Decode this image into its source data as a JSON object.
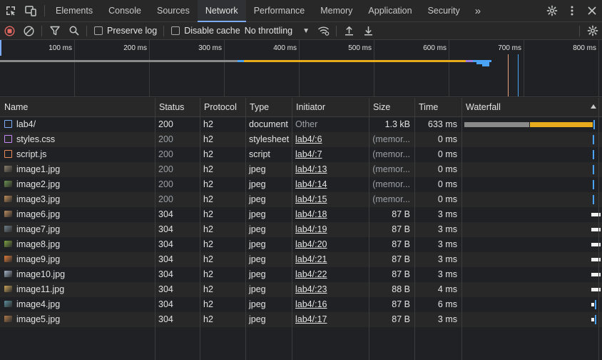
{
  "tabs": [
    "Elements",
    "Console",
    "Sources",
    "Network",
    "Performance",
    "Memory",
    "Application",
    "Security"
  ],
  "active_tab": "Network",
  "toolbar": {
    "preserve_log": "Preserve log",
    "disable_cache": "Disable cache",
    "throttling": "No throttling"
  },
  "overview": {
    "ticks": [
      "100 ms",
      "200 ms",
      "300 ms",
      "400 ms",
      "500 ms",
      "600 ms",
      "700 ms",
      "800 ms"
    ]
  },
  "columns": [
    "Name",
    "Status",
    "Protocol",
    "Type",
    "Initiator",
    "Size",
    "Time",
    "Waterfall"
  ],
  "rows": [
    {
      "name": "lab4/",
      "status": "200",
      "protocol": "h2",
      "type": "document",
      "initiator": "Other",
      "size": "1.3 kB",
      "time": "633 ms",
      "icon": "document-icon",
      "status_dim": false,
      "initiator_dim": true,
      "size_dim": false
    },
    {
      "name": "styles.css",
      "status": "200",
      "protocol": "h2",
      "type": "stylesheet",
      "initiator": "lab4/:6",
      "size": "(memor...",
      "time": "0 ms",
      "icon": "stylesheet-icon",
      "status_dim": true,
      "initiator_dim": false,
      "size_dim": true
    },
    {
      "name": "script.js",
      "status": "200",
      "protocol": "h2",
      "type": "script",
      "initiator": "lab4/:7",
      "size": "(memor...",
      "time": "0 ms",
      "icon": "script-icon",
      "status_dim": true,
      "initiator_dim": false,
      "size_dim": true
    },
    {
      "name": "image1.jpg",
      "status": "200",
      "protocol": "h2",
      "type": "jpeg",
      "initiator": "lab4/:13",
      "size": "(memor...",
      "time": "0 ms",
      "icon": "image-thumbnail-icon",
      "status_dim": true,
      "initiator_dim": false,
      "size_dim": true
    },
    {
      "name": "image2.jpg",
      "status": "200",
      "protocol": "h2",
      "type": "jpeg",
      "initiator": "lab4/:14",
      "size": "(memor...",
      "time": "0 ms",
      "icon": "image-thumbnail-icon",
      "status_dim": true,
      "initiator_dim": false,
      "size_dim": true
    },
    {
      "name": "image3.jpg",
      "status": "200",
      "protocol": "h2",
      "type": "jpeg",
      "initiator": "lab4/:15",
      "size": "(memor...",
      "time": "0 ms",
      "icon": "image-thumbnail-icon",
      "status_dim": true,
      "initiator_dim": false,
      "size_dim": true
    },
    {
      "name": "image6.jpg",
      "status": "304",
      "protocol": "h2",
      "type": "jpeg",
      "initiator": "lab4/:18",
      "size": "87 B",
      "time": "3 ms",
      "icon": "image-thumbnail-icon",
      "status_dim": false,
      "initiator_dim": false,
      "size_dim": false
    },
    {
      "name": "image7.jpg",
      "status": "304",
      "protocol": "h2",
      "type": "jpeg",
      "initiator": "lab4/:19",
      "size": "87 B",
      "time": "3 ms",
      "icon": "image-thumbnail-icon",
      "status_dim": false,
      "initiator_dim": false,
      "size_dim": false
    },
    {
      "name": "image8.jpg",
      "status": "304",
      "protocol": "h2",
      "type": "jpeg",
      "initiator": "lab4/:20",
      "size": "87 B",
      "time": "3 ms",
      "icon": "image-thumbnail-icon",
      "status_dim": false,
      "initiator_dim": false,
      "size_dim": false
    },
    {
      "name": "image9.jpg",
      "status": "304",
      "protocol": "h2",
      "type": "jpeg",
      "initiator": "lab4/:21",
      "size": "87 B",
      "time": "3 ms",
      "icon": "image-thumbnail-icon",
      "status_dim": false,
      "initiator_dim": false,
      "size_dim": false
    },
    {
      "name": "image10.jpg",
      "status": "304",
      "protocol": "h2",
      "type": "jpeg",
      "initiator": "lab4/:22",
      "size": "87 B",
      "time": "3 ms",
      "icon": "image-thumbnail-icon",
      "status_dim": false,
      "initiator_dim": false,
      "size_dim": false
    },
    {
      "name": "image11.jpg",
      "status": "304",
      "protocol": "h2",
      "type": "jpeg",
      "initiator": "lab4/:23",
      "size": "88 B",
      "time": "4 ms",
      "icon": "image-thumbnail-icon",
      "status_dim": false,
      "initiator_dim": false,
      "size_dim": false
    },
    {
      "name": "image4.jpg",
      "status": "304",
      "protocol": "h2",
      "type": "jpeg",
      "initiator": "lab4/:16",
      "size": "87 B",
      "time": "6 ms",
      "icon": "image-thumbnail-icon",
      "status_dim": false,
      "initiator_dim": false,
      "size_dim": false
    },
    {
      "name": "image5.jpg",
      "status": "304",
      "protocol": "h2",
      "type": "jpeg",
      "initiator": "lab4/:17",
      "size": "87 B",
      "time": "3 ms",
      "icon": "image-thumbnail-icon",
      "status_dim": false,
      "initiator_dim": false,
      "size_dim": false
    }
  ],
  "colors": {
    "accent": "#7cacf8",
    "record": "#e46962",
    "waterfall_waiting": "#8a8a8a",
    "waterfall_download": "#e8ab1d",
    "waterfall_tick": "#4aa3f4",
    "waterfall_bar": "#f1f1f1"
  }
}
